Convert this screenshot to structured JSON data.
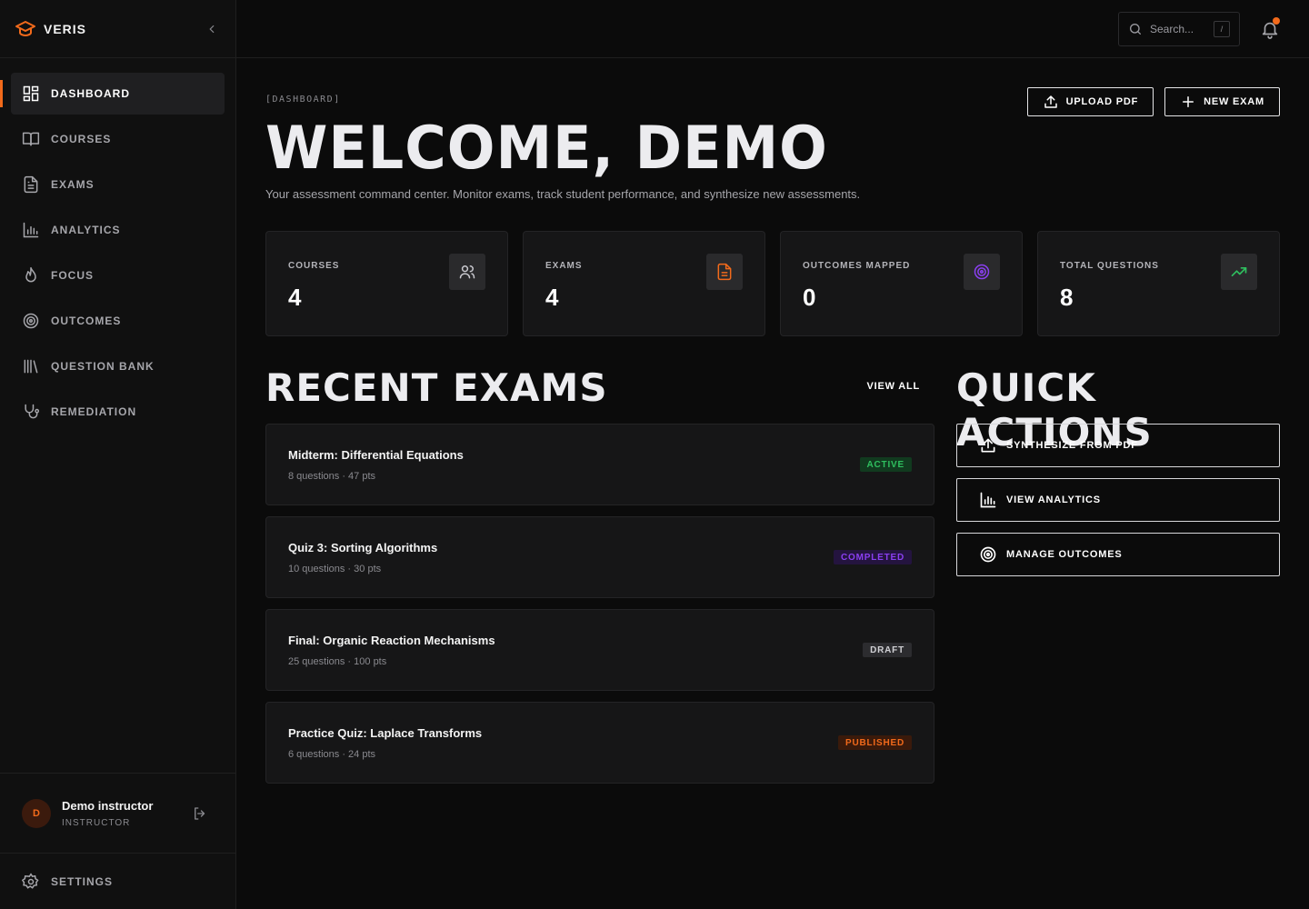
{
  "app": {
    "name": "VERIS"
  },
  "sidebar": {
    "items": [
      {
        "label": "DASHBOARD",
        "icon": "dashboard-icon",
        "active": true
      },
      {
        "label": "COURSES",
        "icon": "book-icon",
        "active": false
      },
      {
        "label": "EXAMS",
        "icon": "document-icon",
        "active": false
      },
      {
        "label": "ANALYTICS",
        "icon": "bar-chart-icon",
        "active": false
      },
      {
        "label": "FOCUS",
        "icon": "flame-icon",
        "active": false
      },
      {
        "label": "OUTCOMES",
        "icon": "target-icon",
        "active": false
      },
      {
        "label": "QUESTION BANK",
        "icon": "library-icon",
        "active": false
      },
      {
        "label": "REMEDIATION",
        "icon": "stethoscope-icon",
        "active": false
      }
    ],
    "user": {
      "initial": "D",
      "name": "Demo instructor",
      "role": "INSTRUCTOR"
    },
    "settings_label": "SETTINGS"
  },
  "topbar": {
    "search_placeholder": "Search...",
    "search_shortcut": "/"
  },
  "header": {
    "breadcrumb": "[DASHBOARD]",
    "title": "WELCOME, DEMO",
    "subtitle": "Your assessment command center. Monitor exams, track student performance, and synthesize new assessments.",
    "upload_label": "UPLOAD PDF",
    "new_exam_label": "NEW EXAM"
  },
  "stats": [
    {
      "label": "COURSES",
      "value": "4",
      "icon": "users-icon",
      "color": "#c9c9cf"
    },
    {
      "label": "EXAMS",
      "value": "4",
      "icon": "document-icon",
      "color": "#f26a1b"
    },
    {
      "label": "OUTCOMES MAPPED",
      "value": "0",
      "icon": "target-icon",
      "color": "#8b3ff2"
    },
    {
      "label": "TOTAL QUESTIONS",
      "value": "8",
      "icon": "trending-up-icon",
      "color": "#2fbf5f"
    }
  ],
  "recent": {
    "title": "RECENT EXAMS",
    "view_all": "VIEW ALL",
    "exams": [
      {
        "title": "Midterm: Differential Equations",
        "meta": "8 questions · 47 pts",
        "status": "ACTIVE"
      },
      {
        "title": "Quiz 3: Sorting Algorithms",
        "meta": "10 questions · 30 pts",
        "status": "COMPLETED"
      },
      {
        "title": "Final: Organic Reaction Mechanisms",
        "meta": "25 questions · 100 pts",
        "status": "DRAFT"
      },
      {
        "title": "Practice Quiz: Laplace Transforms",
        "meta": "6 questions · 24 pts",
        "status": "PUBLISHED"
      }
    ]
  },
  "quick": {
    "title": "QUICK ACTIONS",
    "actions": [
      {
        "label": "SYNTHESIZE FROM PDF",
        "icon": "upload-icon"
      },
      {
        "label": "VIEW ANALYTICS",
        "icon": "bar-chart-icon"
      },
      {
        "label": "MANAGE OUTCOMES",
        "icon": "target-icon"
      }
    ]
  },
  "colors": {
    "accent": "#f26a1b",
    "active": "#2fbf5f",
    "completed": "#8b3ff2",
    "draft": "#d0d0d4",
    "published": "#f26a1b"
  }
}
